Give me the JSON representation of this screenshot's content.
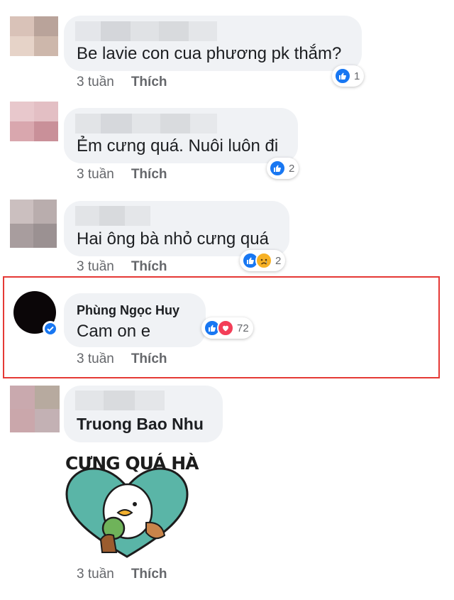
{
  "comments": [
    {
      "text": "Be lavie con cua phương pk thắm?",
      "time": "3 tuần",
      "like_label": "Thích",
      "reaction_count": "1",
      "reactions": [
        "like-icon"
      ]
    },
    {
      "text": "Ẻm cưng quá. Nuôi luôn đi",
      "time": "3 tuần",
      "like_label": "Thích",
      "reaction_count": "2",
      "reactions": [
        "like-icon"
      ]
    },
    {
      "text": "Hai ông bà nhỏ cưng quá",
      "time": "3 tuần",
      "like_label": "Thích",
      "reaction_count": "2",
      "reactions": [
        "like-icon",
        "sad-icon"
      ]
    },
    {
      "author": "Phùng Ngọc Huy",
      "text": "Cam on e",
      "time": "3 tuần",
      "like_label": "Thích",
      "reaction_count": "72",
      "reactions": [
        "like-icon",
        "love-icon"
      ],
      "verified": true,
      "highlighted": true
    },
    {
      "text": "Truong Bao Nhu",
      "time": "3 tuần",
      "like_label": "Thích",
      "sticker": {
        "title": "CƯNG QUÁ HÀ"
      }
    }
  ],
  "colors": {
    "like": "#1877f2",
    "love": "#f33e58",
    "highlight": "#e53935",
    "verified": "#1877f2"
  }
}
